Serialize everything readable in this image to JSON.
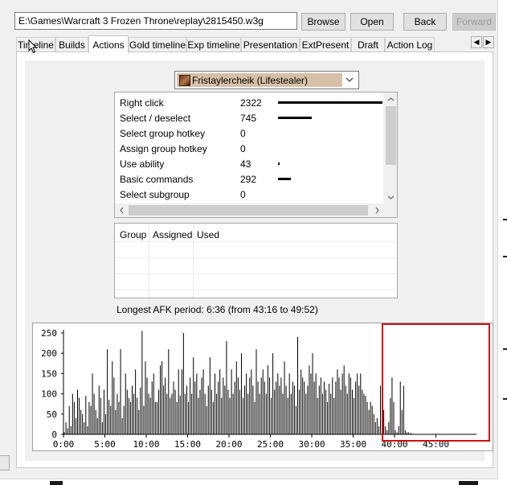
{
  "toolbar": {
    "path_value": "E:\\Games\\Warcraft 3 Frozen Throne\\replay\\2815450.w3g",
    "browse_label": "Browse",
    "open_label": "Open",
    "back_label": "Back",
    "forward_label": "Forward"
  },
  "tabs": [
    {
      "label": "Timeline",
      "active": false
    },
    {
      "label": "Builds",
      "active": false
    },
    {
      "label": "Actions",
      "active": true
    },
    {
      "label": "Gold timeline",
      "active": false
    },
    {
      "label": "Exp timeline",
      "active": false
    },
    {
      "label": "Presentation",
      "active": false
    },
    {
      "label": "ExtPresent",
      "active": false
    },
    {
      "label": "Draft",
      "active": false
    },
    {
      "label": "Action Log",
      "active": false
    }
  ],
  "tab_scroll": {
    "left_icon": "chevron-left-icon",
    "right_icon": "chevron-right-icon",
    "left_glyph": "◀",
    "right_glyph": "▶"
  },
  "player_select": {
    "selected": "Fristaylercheik (Lifestealer)",
    "avatar_icon": "hero-portrait-icon",
    "dropdown_icon": "chevron-down-icon"
  },
  "actions": {
    "rows": [
      {
        "name": "Right click",
        "count": 2322
      },
      {
        "name": "Select / deselect",
        "count": 745
      },
      {
        "name": "Select group hotkey",
        "count": 0
      },
      {
        "name": "Assign group hotkey",
        "count": 0
      },
      {
        "name": "Use ability",
        "count": 43
      },
      {
        "name": "Basic commands",
        "count": 292
      },
      {
        "name": "Select subgroup",
        "count": 0
      }
    ],
    "max_count": 2322
  },
  "groups": {
    "headers": [
      "Group",
      "Assigned",
      "Used"
    ]
  },
  "afk": {
    "text": "Longest AFK period: 6:36 (from 43:16 to 49:52)"
  },
  "highlight_color": "#d01010",
  "chart_data": {
    "type": "bar",
    "title": "",
    "xlabel": "",
    "ylabel": "",
    "ylim": [
      0,
      250
    ],
    "y_ticks": [
      0,
      50,
      100,
      150,
      200,
      250
    ],
    "x_ticks": [
      "0:00",
      "5:00",
      "10:00",
      "15:00",
      "20:00",
      "25:00",
      "30:00",
      "35:00",
      "40:00",
      "45:00"
    ],
    "x_range_minutes": [
      0,
      49.9
    ],
    "bin_seconds": 12,
    "values": [
      5,
      30,
      15,
      70,
      20,
      100,
      80,
      40,
      110,
      90,
      60,
      50,
      30,
      95,
      20,
      80,
      70,
      150,
      100,
      60,
      40,
      120,
      90,
      30,
      110,
      50,
      210,
      85,
      70,
      180,
      140,
      60,
      100,
      80,
      210,
      40,
      70,
      150,
      110,
      90,
      80,
      120,
      100,
      160,
      90,
      60,
      115,
      255,
      70,
      180,
      140,
      100,
      90,
      130,
      150,
      80,
      80,
      110,
      170,
      180,
      120,
      140,
      100,
      210,
      90,
      100,
      130,
      110,
      80,
      160,
      95,
      160,
      250,
      100,
      120,
      80,
      140,
      100,
      190,
      130,
      150,
      90,
      110,
      140,
      160,
      100,
      70,
      120,
      190,
      110,
      80,
      150,
      100,
      130,
      160,
      90,
      140,
      120,
      230,
      110,
      90,
      160,
      100,
      130,
      180,
      140,
      110,
      200,
      90,
      120,
      150,
      100,
      140,
      160,
      120,
      80,
      210,
      130,
      100,
      140,
      160,
      130,
      100,
      170,
      140,
      90,
      200,
      110,
      130,
      150,
      120,
      140,
      100,
      180,
      120,
      90,
      150,
      100,
      130,
      120,
      70,
      240,
      110,
      160,
      140,
      130,
      100,
      120,
      170,
      150,
      200,
      130,
      150,
      90,
      120,
      140,
      100,
      130,
      110,
      80,
      125,
      100,
      140,
      90,
      130,
      160,
      140,
      110,
      150,
      170,
      120,
      100,
      150,
      140,
      110,
      90,
      130,
      150,
      120,
      150,
      110,
      100,
      95,
      80,
      60,
      80,
      70,
      50,
      30,
      40,
      20,
      120,
      190,
      60,
      20,
      10,
      30,
      90,
      140,
      80,
      10,
      5,
      20,
      130,
      60,
      120,
      10,
      5,
      5,
      3,
      2,
      0,
      0,
      0,
      0,
      0,
      0,
      0,
      0,
      0,
      0,
      0,
      0,
      0,
      0,
      0,
      0,
      0,
      0,
      0,
      0,
      0,
      0,
      0,
      0,
      0,
      0,
      0,
      0,
      0,
      0,
      0,
      0,
      0,
      0,
      0,
      0,
      0
    ]
  }
}
